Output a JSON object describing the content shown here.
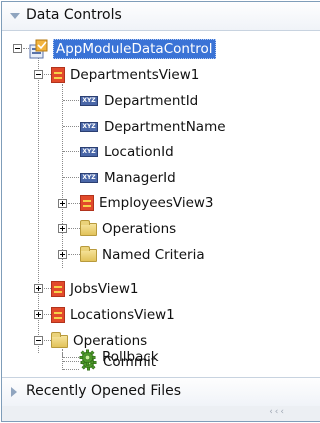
{
  "header": {
    "title": "Data Controls"
  },
  "tree": {
    "root": "AppModuleDataControl",
    "departments_view": "DepartmentsView1",
    "attributes": [
      "DepartmentId",
      "DepartmentName",
      "LocationId",
      "ManagerId"
    ],
    "attr_badge": "XYZ",
    "employees_view": "EmployeesView3",
    "dept_operations": "Operations",
    "named_criteria": "Named Criteria",
    "jobs_view": "JobsView1",
    "locations_view": "LocationsView1",
    "root_operations": "Operations",
    "commit": "Commit",
    "rollback": "Rollback"
  },
  "footer": {
    "title": "Recently Opened Files"
  },
  "statusbar": {
    "grip": "‹‹‹"
  },
  "colors": {
    "selection": "#3a73d6",
    "border": "#7f9db9"
  }
}
